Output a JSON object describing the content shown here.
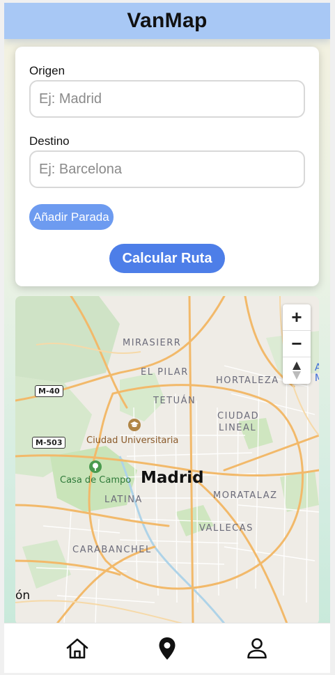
{
  "app": {
    "title": "VanMap"
  },
  "form": {
    "origin": {
      "label": "Origen",
      "placeholder": "Ej: Madrid",
      "value": ""
    },
    "destination": {
      "label": "Destino",
      "placeholder": "Ej: Barcelona",
      "value": ""
    },
    "add_stop_label": "Añadir Parada",
    "calculate_label": "Calcular Ruta"
  },
  "map": {
    "city_label": "Madrid",
    "districts": [
      "MIRASIERR",
      "EL PILAR",
      "HORTALEZA",
      "TETUÁN",
      "CIUDAD",
      "LINEAL",
      "LATINA",
      "MORATALAZ",
      "VALLECAS",
      "CARABANCHEL"
    ],
    "pois": [
      "Ciudad Universitaria",
      "Casa de Campo"
    ],
    "road_shields": [
      "M-40",
      "M-503"
    ],
    "edge_text": "ón",
    "attribution_fragment": [
      "A",
      "M"
    ],
    "controls": {
      "zoom_in": "+",
      "zoom_out": "−",
      "compass": "compass-icon"
    }
  },
  "bottom_nav": {
    "items": [
      {
        "name": "home",
        "icon": "home-icon"
      },
      {
        "name": "location",
        "icon": "location-pin-icon"
      },
      {
        "name": "profile",
        "icon": "user-icon"
      }
    ]
  },
  "colors": {
    "header_bg": "#a8c8f5",
    "primary_button": "#4d7ee8",
    "secondary_button": "#6d9bf0",
    "map_roads": "#f2b96a",
    "map_parks": "#c9e4b9"
  }
}
